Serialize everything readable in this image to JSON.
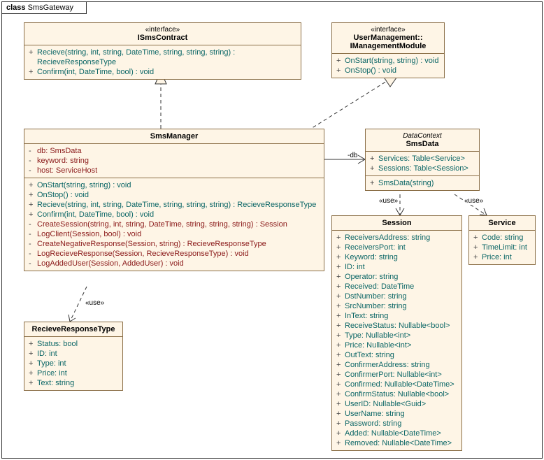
{
  "frame": {
    "keyword": "class",
    "name": "SmsGateway"
  },
  "classes": {
    "isms": {
      "stereotype": "«interface»",
      "name": "ISmsContract",
      "ops": [
        {
          "v": "+",
          "t": "Recieve(string, int, string, DateTime, string, string, string) : RecieveResponseType"
        },
        {
          "v": "+",
          "t": "Confirm(int, DateTime, bool) : void"
        }
      ]
    },
    "imgmt": {
      "stereotype": "«interface»",
      "name1": "UserManagement::",
      "name2": "IManagementModule",
      "ops": [
        {
          "v": "+",
          "t": "OnStart(string, string) : void"
        },
        {
          "v": "+",
          "t": "OnStop() : void"
        }
      ]
    },
    "smsmgr": {
      "name": "SmsManager",
      "attrs": [
        {
          "v": "-",
          "t": "db: SmsData"
        },
        {
          "v": "-",
          "t": "keyword: string"
        },
        {
          "v": "-",
          "t": "host: ServiceHost"
        }
      ],
      "ops": [
        {
          "v": "+",
          "t": "OnStart(string, string) : void"
        },
        {
          "v": "+",
          "t": "OnStop() : void"
        },
        {
          "v": "+",
          "t": "Recieve(string, int, string, DateTime, string, string, string) : RecieveResponseType"
        },
        {
          "v": "+",
          "t": "Confirm(int, DateTime, bool) : void"
        },
        {
          "v": "-",
          "t": "CreateSession(string, int, string, DateTime, string, string, string) : Session"
        },
        {
          "v": "-",
          "t": "LogClient(Session, bool) : void"
        },
        {
          "v": "-",
          "t": "CreateNegativeResponse(Session, string) : RecieveResponseType"
        },
        {
          "v": "-",
          "t": "LogRecieveResponse(Session, RecieveResponseType) : void"
        },
        {
          "v": "-",
          "t": "LogAddedUser(Session, AddedUser) : void"
        }
      ]
    },
    "smsdata": {
      "stereoname": "DataContext",
      "name": "SmsData",
      "attrs": [
        {
          "v": "+",
          "t": "Services: Table<Service>"
        },
        {
          "v": "+",
          "t": "Sessions: Table<Session>"
        }
      ],
      "ops": [
        {
          "v": "+",
          "t": "SmsData(string)"
        }
      ]
    },
    "rrt": {
      "name": "RecieveResponseType",
      "attrs": [
        {
          "v": "+",
          "t": "Status: bool"
        },
        {
          "v": "+",
          "t": "ID: int"
        },
        {
          "v": "+",
          "t": "Type: int"
        },
        {
          "v": "+",
          "t": "Price: int"
        },
        {
          "v": "+",
          "t": "Text: string"
        }
      ]
    },
    "session": {
      "name": "Session",
      "attrs": [
        {
          "v": "+",
          "t": "ReceiversAddress: string"
        },
        {
          "v": "+",
          "t": "ReceiversPort: int"
        },
        {
          "v": "+",
          "t": "Keyword: string"
        },
        {
          "v": "+",
          "t": "ID: int"
        },
        {
          "v": "+",
          "t": "Operator: string"
        },
        {
          "v": "+",
          "t": "Received: DateTime"
        },
        {
          "v": "+",
          "t": "DstNumber: string"
        },
        {
          "v": "+",
          "t": "SrcNumber: string"
        },
        {
          "v": "+",
          "t": "InText: string"
        },
        {
          "v": "+",
          "t": "ReceiveStatus: Nullable<bool>"
        },
        {
          "v": "+",
          "t": "Type: Nullable<int>"
        },
        {
          "v": "+",
          "t": "Price: Nullable<int>"
        },
        {
          "v": "+",
          "t": "OutText: string"
        },
        {
          "v": "+",
          "t": "ConfirmerAddress: string"
        },
        {
          "v": "+",
          "t": "ConfirmerPort: Nullable<int>"
        },
        {
          "v": "+",
          "t": "Confirmed: Nullable<DateTime>"
        },
        {
          "v": "+",
          "t": "ConfirmStatus: Nullable<bool>"
        },
        {
          "v": "+",
          "t": "UserID: Nullable<Guid>"
        },
        {
          "v": "+",
          "t": "UserName: string"
        },
        {
          "v": "+",
          "t": "Password: string"
        },
        {
          "v": "+",
          "t": "Added: Nullable<DateTime>"
        },
        {
          "v": "+",
          "t": "Removed: Nullable<DateTime>"
        }
      ]
    },
    "service": {
      "name": "Service",
      "attrs": [
        {
          "v": "+",
          "t": "Code: string"
        },
        {
          "v": "+",
          "t": "TimeLimit: int"
        },
        {
          "v": "+",
          "t": "Price: int"
        }
      ]
    }
  },
  "labels": {
    "use": "«use»",
    "db": "-db"
  }
}
